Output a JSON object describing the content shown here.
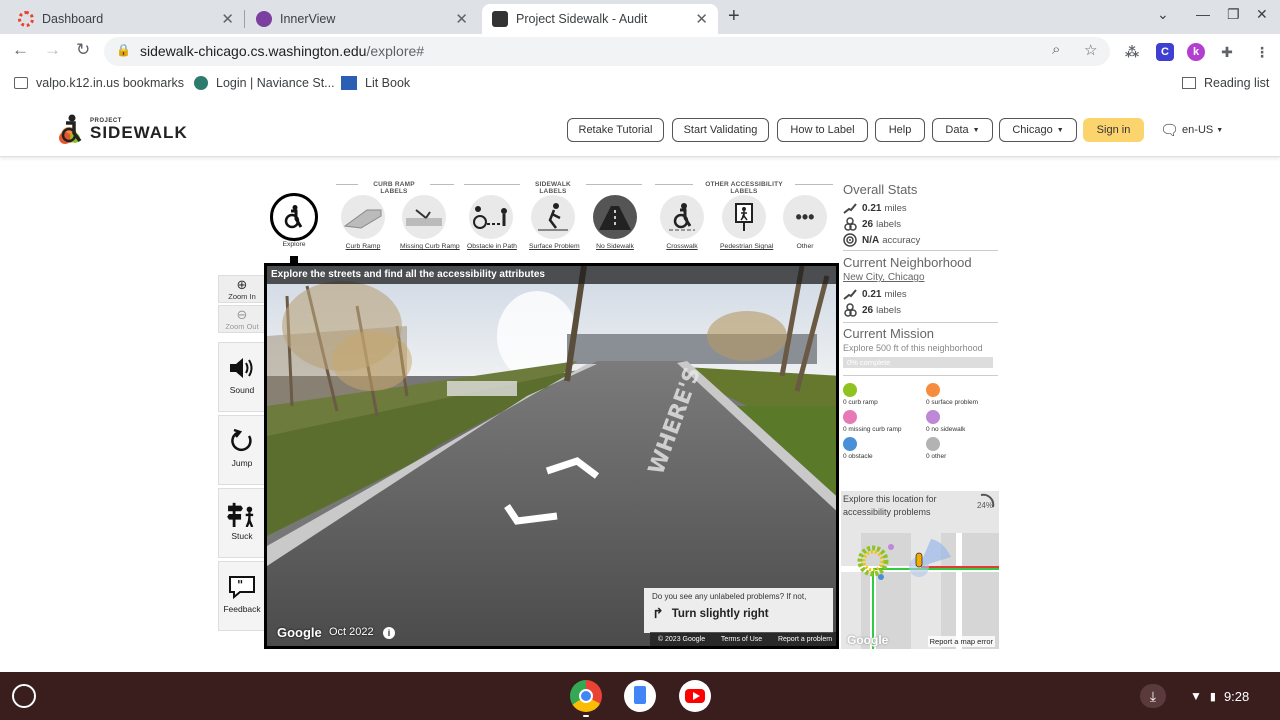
{
  "browser": {
    "tabs": [
      {
        "title": "Dashboard"
      },
      {
        "title": "InnerView"
      },
      {
        "title": "Project Sidewalk - Audit"
      }
    ],
    "url_host": "sidewalk-chicago.cs.washington.edu",
    "url_path": "/explore#",
    "bookmarks": [
      "valpo.k12.in.us bookmarks",
      "Login | Naviance St...",
      "Lit Book"
    ],
    "reading_list": "Reading list",
    "extensions": [
      "C",
      "k"
    ]
  },
  "site": {
    "logo_small": "PROJECT",
    "logo_big": "SIDEWALK",
    "nav": {
      "retake_tutorial": "Retake Tutorial",
      "start_validating": "Start Validating",
      "how_to_label": "How to Label",
      "help": "Help",
      "data": "Data",
      "city": "Chicago",
      "sign_in": "Sign in",
      "language": "en-US"
    }
  },
  "label_toolbar": {
    "groups": {
      "curb_ramp": "CURB RAMP LABELS",
      "sidewalk": "SIDEWALK LABELS",
      "other": "OTHER ACCESSIBILITY LABELS"
    },
    "tools": {
      "explore": "Explore",
      "curb_ramp": "Curb Ramp",
      "missing_curb_ramp": "Missing Curb Ramp",
      "obstacle": "Obstacle in Path",
      "surface_problem": "Surface Problem",
      "no_sidewalk": "No Sidewalk",
      "crosswalk": "Crosswalk",
      "pedestrian_signal": "Pedestrian Signal",
      "other": "Other"
    }
  },
  "side_controls": {
    "zoom_in": "Zoom In",
    "zoom_out": "Zoom Out",
    "sound": "Sound",
    "jump": "Jump",
    "stuck": "Stuck",
    "feedback": "Feedback"
  },
  "streetview": {
    "title": "Explore the streets and find all the accessibility attributes",
    "google": "Google",
    "date": "Oct 2022",
    "road_marking": "WHERE'S",
    "tip_question": "Do you see any unlabeled problems? If not,",
    "tip_action": "Turn slightly right",
    "footer": [
      "© 2023 Google",
      "Terms of Use",
      "Report a problem"
    ]
  },
  "overall_stats": {
    "title": "Overall Stats",
    "miles_value": "0.21",
    "miles_unit": "miles",
    "labels_value": "26",
    "labels_unit": "labels",
    "accuracy_value": "N/A",
    "accuracy_unit": "accuracy"
  },
  "neighborhood": {
    "title": "Current Neighborhood",
    "name": "New City, Chicago",
    "miles_value": "0.21",
    "miles_unit": "miles",
    "labels_value": "26",
    "labels_unit": "labels"
  },
  "mission": {
    "title": "Current Mission",
    "desc": "Explore 500 ft of this neighborhood",
    "progress_text": "0% complete",
    "progress": 0
  },
  "mission_counts": {
    "curb_ramp": "0 curb ramp",
    "surface_problem": "0 surface problem",
    "missing_curb_ramp": "0 missing curb ramp",
    "no_sidewalk": "0 no sidewalk",
    "obstacle": "0 obstacle",
    "other": "0 other"
  },
  "minimap": {
    "text": "Explore this location for accessibility problems",
    "percent": "24%",
    "google": "Google",
    "report": "Report a map error"
  },
  "shelf": {
    "time": "9:28"
  },
  "colors": {
    "accent_signin": "#fbd46d",
    "curb_ramp": "#90c31f",
    "missing_curb_ramp": "#e679b6",
    "obstacle": "#78c9ab",
    "surface_problem": "#f68d3e",
    "no_sidewalk": "#be87d8",
    "other": "#b3b3b3",
    "shelf": "#3a1e1e"
  }
}
